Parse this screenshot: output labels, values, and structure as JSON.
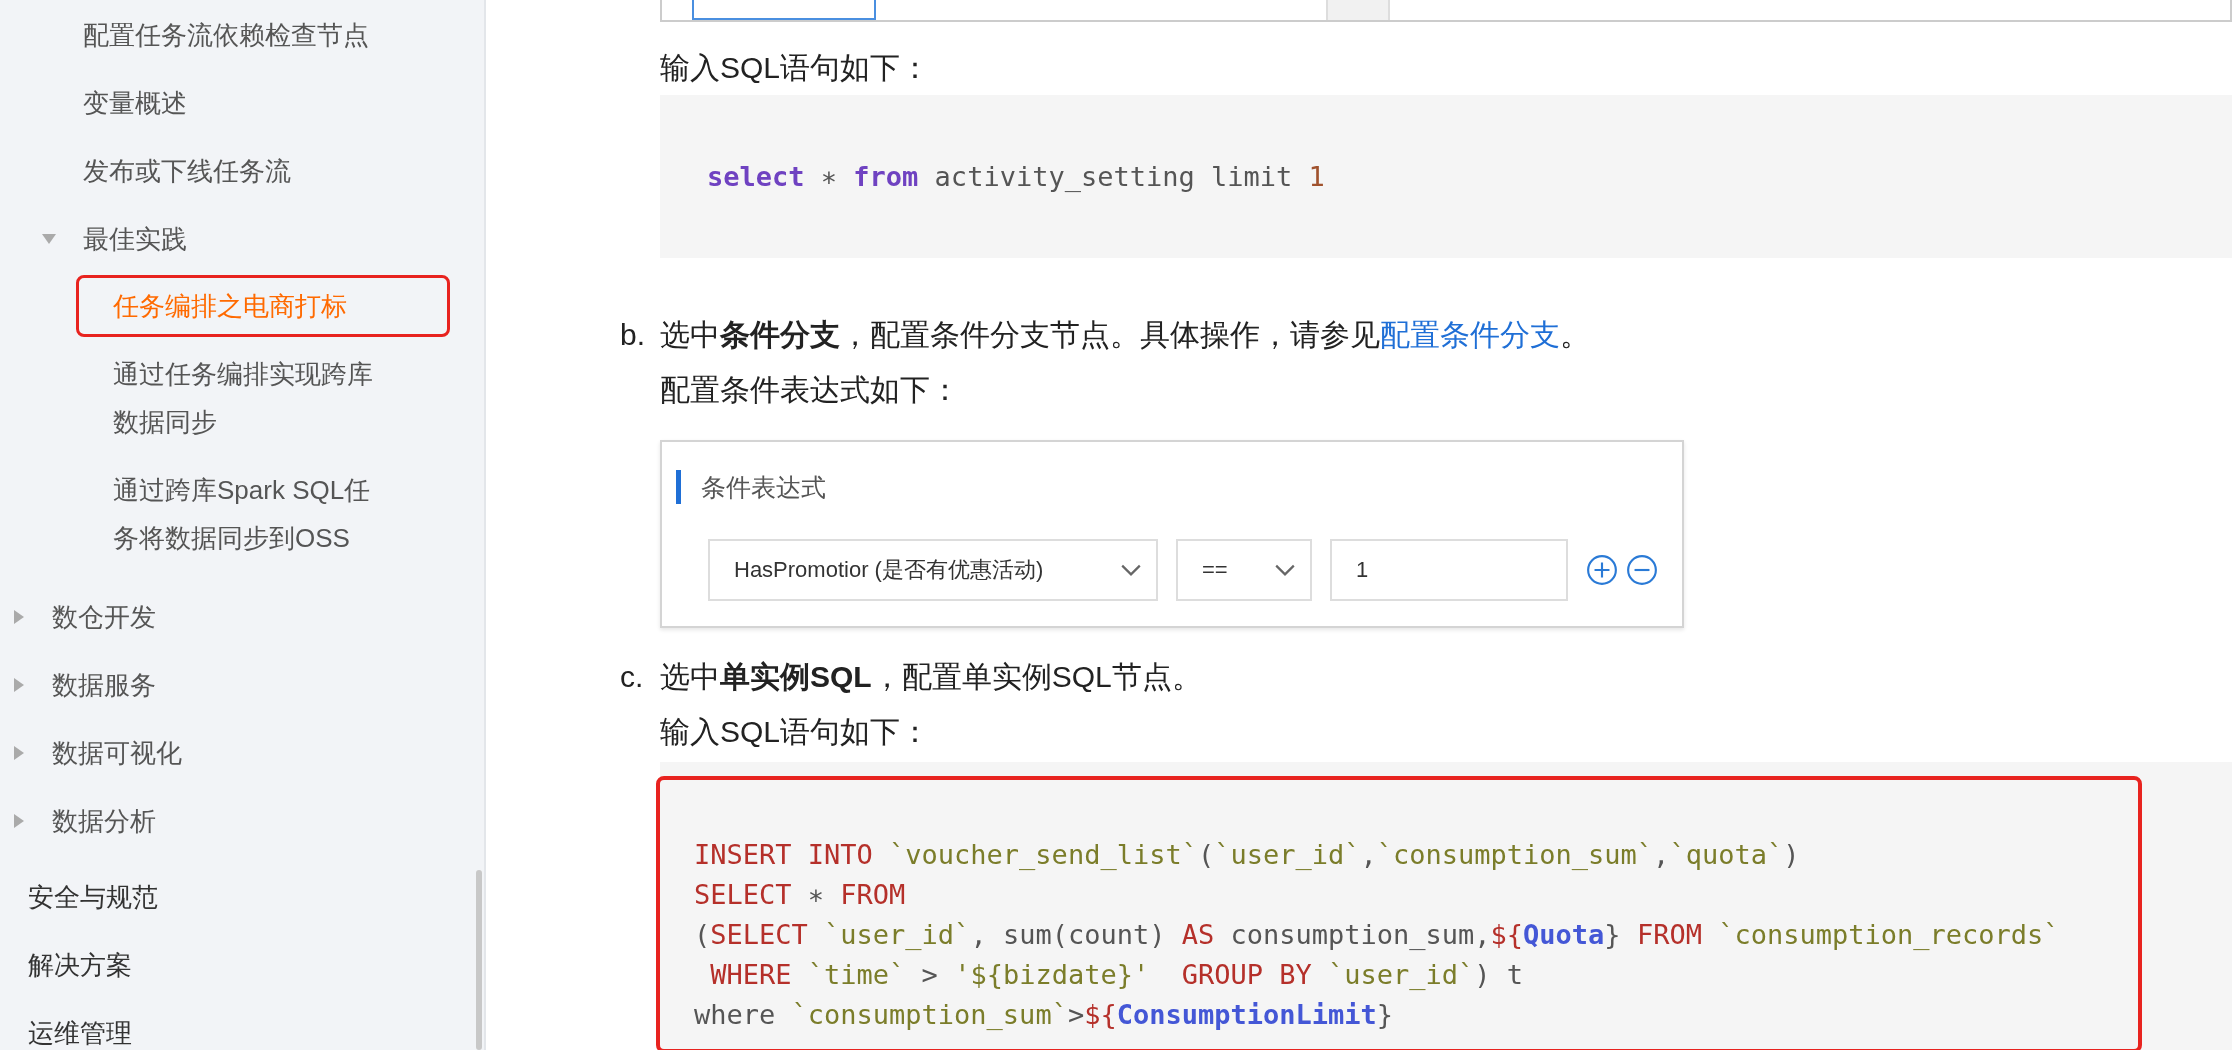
{
  "sidebar": {
    "nested_items": [
      {
        "label": "配置任务流依赖检查节点"
      },
      {
        "label": "变量概述"
      },
      {
        "label": "发布或下线任务流"
      },
      {
        "label": "最佳实践",
        "expanded": true,
        "children": [
          {
            "label": "任务编排之电商打标",
            "selected": true
          },
          {
            "label": "通过任务编排实现跨库数据同步",
            "selected": false
          },
          {
            "label": "通过跨库Spark SQL任务将数据同步到OSS",
            "selected": false
          }
        ]
      }
    ],
    "section_items": [
      {
        "label": "数仓开发",
        "expanded": false
      },
      {
        "label": "数据服务",
        "expanded": false
      },
      {
        "label": "数据可视化",
        "expanded": false
      },
      {
        "label": "数据分析",
        "expanded": false
      }
    ],
    "top_items": [
      {
        "label": "安全与规范"
      },
      {
        "label": "解决方案"
      },
      {
        "label": "运维管理"
      }
    ]
  },
  "content": {
    "intro": "输入SQL语句如下：",
    "code_block_1": {
      "lines": [
        [
          {
            "kind": "kw",
            "text": "select"
          },
          {
            "kind": "plain",
            "text": " ∗ "
          },
          {
            "kind": "kw",
            "text": "from"
          },
          {
            "kind": "plain",
            "text": " activity_setting limit "
          },
          {
            "kind": "num",
            "text": "1"
          }
        ]
      ]
    },
    "steps": [
      {
        "marker": "b.",
        "text_before": "选中**条件分支**，配置条件分支节点。具体操作，请参见",
        "link": "配置条件分支",
        "text_after": "。",
        "sub_text": "配置条件表达式如下：",
        "figure": {
          "title": "条件表达式",
          "field_select": "HasPromotior (是否有优惠活动)",
          "operator_select": "==",
          "value": "1"
        }
      },
      {
        "marker": "c.",
        "text_before": "选中**单实例SQL**，配置单实例SQL节点。",
        "sub_text": "输入SQL语句如下：",
        "code_block": {
          "highlighted": true,
          "lines": [
            [
              {
                "kind": "red",
                "text": "INSERT INTO"
              },
              {
                "kind": "str",
                "text": " `voucher_send_list`"
              },
              {
                "kind": "plain",
                "text": "("
              },
              {
                "kind": "str",
                "text": "`user_id`"
              },
              {
                "kind": "plain",
                "text": ","
              },
              {
                "kind": "str",
                "text": "`consumption_sum`"
              },
              {
                "kind": "plain",
                "text": ","
              },
              {
                "kind": "str",
                "text": "`quota`"
              },
              {
                "kind": "plain",
                "text": ")"
              }
            ],
            [
              {
                "kind": "red",
                "text": "SELECT"
              },
              {
                "kind": "plain",
                "text": " ∗ "
              },
              {
                "kind": "red",
                "text": "FROM"
              }
            ],
            [
              {
                "kind": "plain",
                "text": "("
              },
              {
                "kind": "red",
                "text": "SELECT"
              },
              {
                "kind": "str",
                "text": " `user_id`"
              },
              {
                "kind": "plain",
                "text": ", sum(count) "
              },
              {
                "kind": "red",
                "text": "AS"
              },
              {
                "kind": "plain",
                "text": " consumption_sum,"
              },
              {
                "kind": "red",
                "text": "${"
              },
              {
                "kind": "var",
                "text": "Quota"
              },
              {
                "kind": "plain",
                "text": "} "
              },
              {
                "kind": "red",
                "text": "FROM"
              },
              {
                "kind": "str",
                "text": " `consumption_records`"
              }
            ],
            [
              {
                "kind": "red",
                "text": " WHERE"
              },
              {
                "kind": "str",
                "text": " `time`"
              },
              {
                "kind": "plain",
                "text": " > "
              },
              {
                "kind": "str",
                "text": "'${bizdate}'"
              },
              {
                "kind": "red",
                "text": "  GROUP BY"
              },
              {
                "kind": "str",
                "text": " `user_id`"
              },
              {
                "kind": "plain",
                "text": ") t"
              }
            ],
            [
              {
                "kind": "plain",
                "text": "where "
              },
              {
                "kind": "str",
                "text": "`consumption_sum`"
              },
              {
                "kind": "plain",
                "text": ">"
              },
              {
                "kind": "red",
                "text": "${"
              },
              {
                "kind": "var",
                "text": "ConsumptionLimit"
              },
              {
                "kind": "plain",
                "text": "}"
              }
            ]
          ]
        }
      }
    ]
  }
}
